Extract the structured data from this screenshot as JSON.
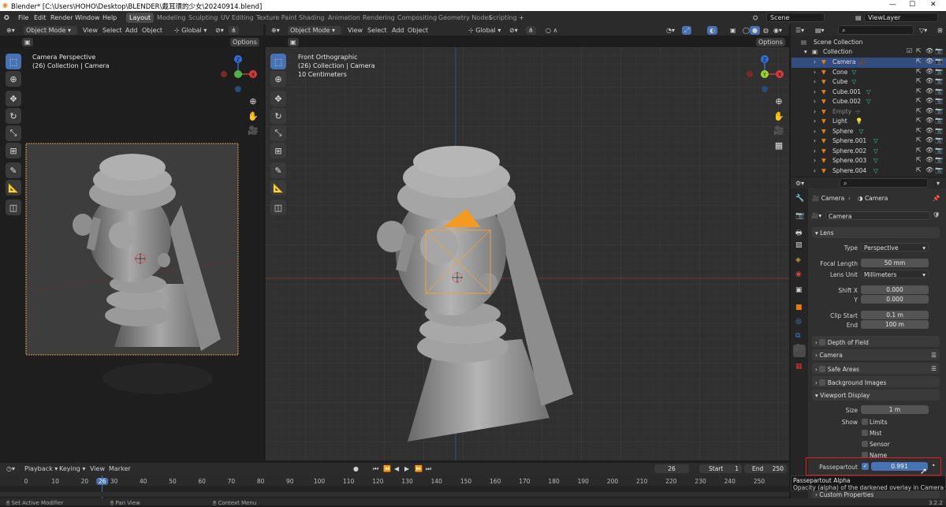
{
  "window": {
    "title": "Blender* [C:\\Users\\HOHO\\Desktop\\BLENDER\\戴耳環的少女\\20240914.blend]"
  },
  "menu": [
    "File",
    "Edit",
    "Render",
    "Window",
    "Help"
  ],
  "workspaces": [
    "Layout",
    "Modeling",
    "Sculpting",
    "UV Editing",
    "Texture Paint",
    "Shading",
    "Animation",
    "Rendering",
    "Compositing",
    "Geometry Nodes",
    "Scripting"
  ],
  "active_workspace": "Layout",
  "scene": "Scene",
  "view_layer": "ViewLayer",
  "left_viewport": {
    "mode": "Object Mode",
    "menus": [
      "View",
      "Select",
      "Add",
      "Object"
    ],
    "orientation": "Global",
    "options": "Options",
    "line1": "Camera Perspective",
    "line2": "(26) Collection | Camera"
  },
  "main_viewport": {
    "mode": "Object Mode",
    "menus": [
      "View",
      "Select",
      "Add",
      "Object"
    ],
    "orientation": "Global",
    "options": "Options",
    "line1": "Front Orthographic",
    "line2": "(26) Collection | Camera",
    "line3": "10 Centimeters"
  },
  "gizmo": {
    "x": "X",
    "y": "Y",
    "z": "Z"
  },
  "outliner": {
    "root": "Scene Collection",
    "collection": "Collection",
    "items": [
      "Camera",
      "Cone",
      "Cube",
      "Cube.001",
      "Cube.002",
      "Empty",
      "Light",
      "Sphere",
      "Sphere.001",
      "Sphere.002",
      "Sphere.003",
      "Sphere.004"
    ]
  },
  "properties": {
    "breadcrumb_a": "Camera",
    "breadcrumb_b": "Camera",
    "data_name": "Camera",
    "lens_panel": "Lens",
    "type_label": "Type",
    "type_value": "Perspective",
    "focal_label": "Focal Length",
    "focal_value": "50 mm",
    "unit_label": "Lens Unit",
    "unit_value": "Millimeters",
    "shiftx_label": "Shift X",
    "shiftx_value": "0.000",
    "y_label": "Y",
    "y_value": "0.000",
    "clipstart_label": "Clip Start",
    "clipstart_value": "0.1 m",
    "end_label": "End",
    "end_value": "100 m",
    "dof_panel": "Depth of Field",
    "camera_panel": "Camera",
    "safe_panel": "Safe Areas",
    "bg_panel": "Background Images",
    "vd_panel": "Viewport Display",
    "size_label": "Size",
    "size_value": "1 m",
    "show_label": "Show",
    "limits": "Limits",
    "mist": "Mist",
    "sensor": "Sensor",
    "name": "Name",
    "pass_label": "Passepartout",
    "pass_value": "0.991",
    "custom_panel": "Custom Properties"
  },
  "tooltip": {
    "title": "Passepartout Alpha",
    "desc": "Opacity (alpha) of the darkened overlay in Camera view."
  },
  "timeline": {
    "menus": [
      "Playback",
      "Keying",
      "View",
      "Marker"
    ],
    "current": "26",
    "start_label": "Start",
    "start": "1",
    "end_label": "End",
    "end": "250",
    "ticks": [
      "0",
      "10",
      "20",
      "26",
      "30",
      "40",
      "50",
      "60",
      "70",
      "80",
      "90",
      "100",
      "110",
      "120",
      "130",
      "140",
      "150",
      "160",
      "170",
      "180",
      "190",
      "200",
      "210",
      "220",
      "230",
      "240",
      "250"
    ]
  },
  "status": {
    "left": "Set Active Modifier",
    "mid": "Pan View",
    "right": "Context Menu",
    "version": "3.2.2"
  }
}
